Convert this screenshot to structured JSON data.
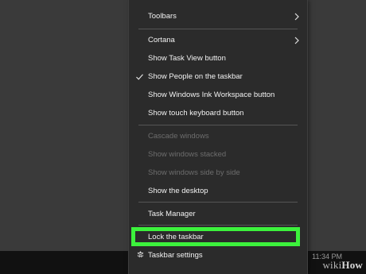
{
  "menu": {
    "items": [
      {
        "label": "Toolbars",
        "submenu": true,
        "enabled": true
      },
      {
        "label": "Cortana",
        "submenu": true,
        "enabled": true
      },
      {
        "label": "Show Task View button",
        "enabled": true
      },
      {
        "label": "Show People on the taskbar",
        "checked": true,
        "enabled": true
      },
      {
        "label": "Show Windows Ink Workspace button",
        "enabled": true
      },
      {
        "label": "Show touch keyboard button",
        "enabled": true
      },
      {
        "label": "Cascade windows",
        "enabled": false
      },
      {
        "label": "Show windows stacked",
        "enabled": false
      },
      {
        "label": "Show windows side by side",
        "enabled": false
      },
      {
        "label": "Show the desktop",
        "enabled": true
      },
      {
        "label": "Task Manager",
        "enabled": true
      },
      {
        "label": "Lock the taskbar",
        "enabled": true,
        "highlighted": true
      },
      {
        "label": "Taskbar settings",
        "icon": "gear-icon",
        "enabled": true
      }
    ]
  },
  "taskbar": {
    "clock_time": "11:34 PM"
  },
  "watermark": {
    "wiki": "wiki",
    "how": "How"
  },
  "colors": {
    "menu_bg": "#2b2b2b",
    "highlight": "#3cf23c",
    "disabled_text": "#6d6d6d"
  }
}
